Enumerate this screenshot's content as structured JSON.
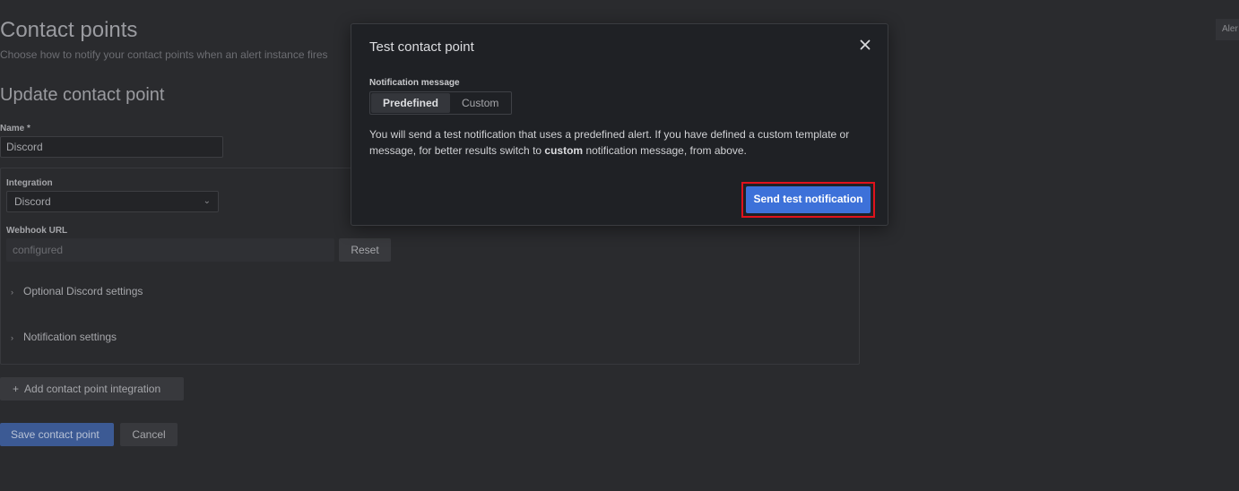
{
  "page": {
    "title": "Contact points",
    "subtitle": "Choose how to notify your contact points when an alert instance fires",
    "section_title": "Update contact point",
    "alert_tab": "Aler"
  },
  "form": {
    "name_label": "Name *",
    "name_value": "Discord",
    "integration_label": "Integration",
    "integration_value": "Discord",
    "webhook_label": "Webhook URL",
    "webhook_placeholder": "configured",
    "reset_label": "Reset",
    "optional_settings_label": "Optional Discord settings",
    "notification_settings_label": "Notification settings",
    "add_integration_label": "Add contact point integration",
    "save_label": "Save contact point",
    "cancel_label": "Cancel"
  },
  "modal": {
    "title": "Test contact point",
    "message_label": "Notification message",
    "options": [
      "Predefined",
      "Custom"
    ],
    "selected_option": "Predefined",
    "description_part1": "You will send a test notification that uses a predefined alert. If you have defined a custom template or message, for better results switch to ",
    "description_bold": "custom",
    "description_part2": " notification message, from above.",
    "send_label": "Send test notification"
  },
  "colors": {
    "primary": "#3d71d9",
    "highlight": "#e0121c",
    "background": "#2a2b2e",
    "modal_bg": "#1f2125"
  },
  "icons": {
    "close": "close-icon",
    "dropdown": "chevron-down-icon",
    "expand": "chevron-right-icon",
    "add": "plus-icon"
  }
}
